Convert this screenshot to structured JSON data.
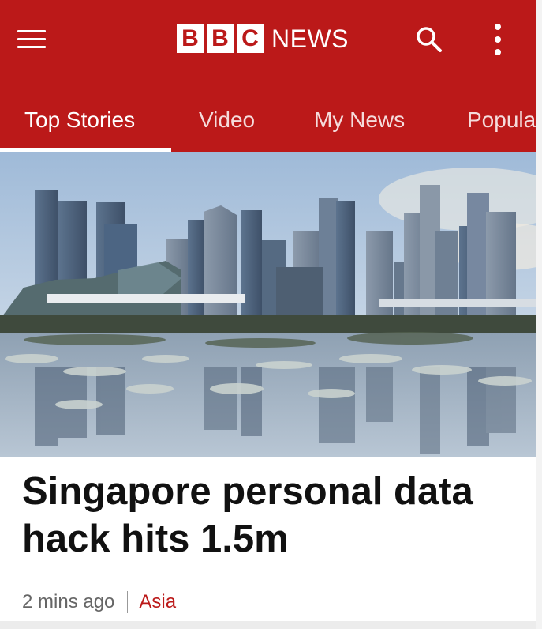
{
  "header": {
    "logo_letters": [
      "B",
      "B",
      "C"
    ],
    "logo_word": "NEWS",
    "brand_color": "#bb1919",
    "menu_icon": "hamburger-menu-icon",
    "search_icon": "search-icon",
    "more_icon": "more-vertical-icon"
  },
  "tabs": [
    {
      "label": "Top Stories",
      "active": true
    },
    {
      "label": "Video",
      "active": false
    },
    {
      "label": "My News",
      "active": false
    },
    {
      "label": "Popula",
      "active": false
    }
  ],
  "article": {
    "headline": "Singapore personal data hack hits 1.5m",
    "time": "2 mins ago",
    "section": "Asia",
    "section_color": "#bb1919"
  }
}
